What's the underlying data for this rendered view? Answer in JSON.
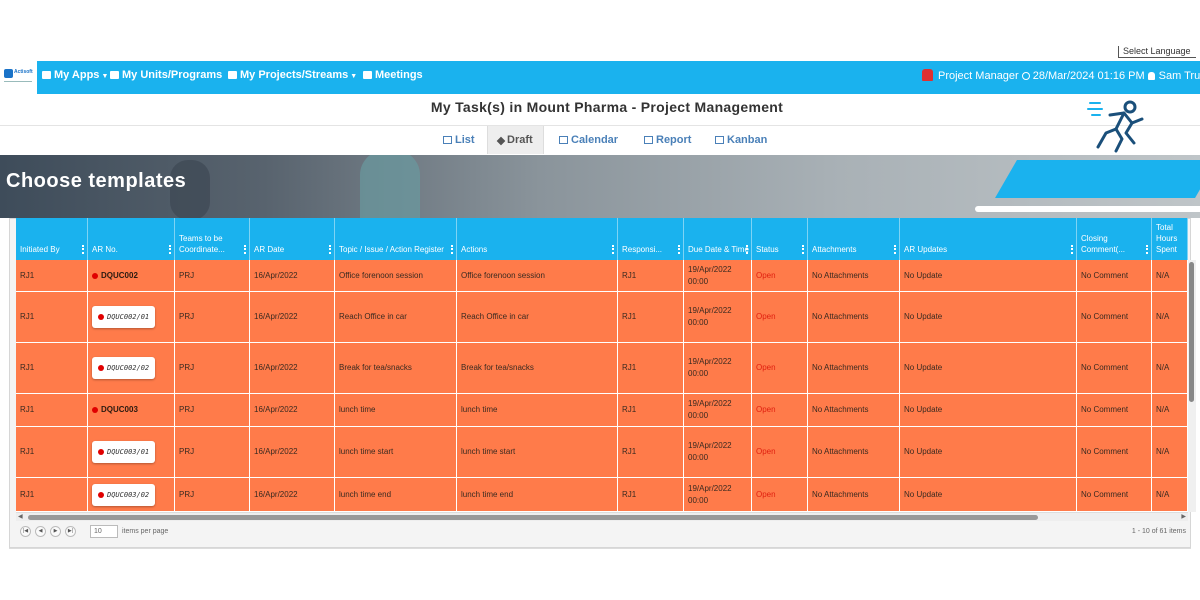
{
  "language_selector": "Select Language",
  "app": {
    "logo_text": "Actisoft"
  },
  "nav": {
    "items": [
      {
        "label": "My Apps",
        "has_caret": true
      },
      {
        "label": "My Units/Programs",
        "has_caret": false
      },
      {
        "label": "My Projects/Streams",
        "has_caret": true
      },
      {
        "label": "Meetings",
        "has_caret": false
      }
    ],
    "role": "Project Manager",
    "datetime": "28/Mar/2024 01:16 PM",
    "user": "Sam Tru"
  },
  "page_title": "My Task(s) in Mount Pharma - Project Management",
  "tabs": [
    {
      "label": "List",
      "icon": "list-icon"
    },
    {
      "label": "Draft",
      "icon": "send-icon",
      "active": true
    },
    {
      "label": "Calendar",
      "icon": "calendar-icon"
    },
    {
      "label": "Report",
      "icon": "tag-icon"
    },
    {
      "label": "Kanban",
      "icon": "chart-icon"
    }
  ],
  "banner": {
    "title": "Choose  templates"
  },
  "grid": {
    "columns": [
      "Initiated By",
      "AR No.",
      "Teams to be Coordinate...",
      "AR Date",
      "Topic / Issue / Action Register",
      "Actions",
      "Responsi...",
      "Due Date & Time",
      "Status",
      "Attachments",
      "AR Updates",
      "Closing Comment(...",
      "Total Hours Spent"
    ],
    "rows": [
      {
        "initiated_by": "RJ1",
        "ar_no": "DQUC002",
        "ar_style": "dot",
        "teams": "PRJ",
        "ar_date": "16/Apr/2022",
        "topic": "Office forenoon session",
        "actions": "Office forenoon session",
        "resp": "RJ1",
        "due": "19/Apr/2022 00:00",
        "status": "Open",
        "attachments": "No Attachments",
        "updates": "No Update",
        "closing": "No Comment",
        "hours": "N/A"
      },
      {
        "initiated_by": "RJ1",
        "ar_no": "DQUC002/01",
        "ar_style": "chip",
        "teams": "PRJ",
        "ar_date": "16/Apr/2022",
        "topic": "Reach Office in car",
        "actions": "Reach Office in car",
        "resp": "RJ1",
        "due": "19/Apr/2022 00:00",
        "status": "Open",
        "attachments": "No Attachments",
        "updates": "No Update",
        "closing": "No Comment",
        "hours": "N/A"
      },
      {
        "initiated_by": "RJ1",
        "ar_no": "DQUC002/02",
        "ar_style": "chip",
        "teams": "PRJ",
        "ar_date": "16/Apr/2022",
        "topic": "Break for tea/snacks",
        "actions": "Break for tea/snacks",
        "resp": "RJ1",
        "due": "19/Apr/2022 00:00",
        "status": "Open",
        "attachments": "No Attachments",
        "updates": "No Update",
        "closing": "No Comment",
        "hours": "N/A"
      },
      {
        "initiated_by": "RJ1",
        "ar_no": "DQUC003",
        "ar_style": "dot",
        "teams": "PRJ",
        "ar_date": "16/Apr/2022",
        "topic": "lunch time",
        "actions": "lunch time",
        "resp": "RJ1",
        "due": "19/Apr/2022 00:00",
        "status": "Open",
        "attachments": "No Attachments",
        "updates": "No Update",
        "closing": "No Comment",
        "hours": "N/A"
      },
      {
        "initiated_by": "RJ1",
        "ar_no": "DQUC003/01",
        "ar_style": "chip",
        "teams": "PRJ",
        "ar_date": "16/Apr/2022",
        "topic": "lunch time start",
        "actions": "lunch time start",
        "resp": "RJ1",
        "due": "19/Apr/2022 00:00",
        "status": "Open",
        "attachments": "No Attachments",
        "updates": "No Update",
        "closing": "No Comment",
        "hours": "N/A"
      },
      {
        "initiated_by": "RJ1",
        "ar_no": "DQUC003/02",
        "ar_style": "chip",
        "teams": "PRJ",
        "ar_date": "16/Apr/2022",
        "topic": "lunch time end",
        "actions": "lunch time end",
        "resp": "RJ1",
        "due": "19/Apr/2022 00:00",
        "status": "Open",
        "attachments": "No Attachments",
        "updates": "No Update",
        "closing": "No Comment",
        "hours": "N/A"
      }
    ]
  },
  "pager": {
    "page_size": "10",
    "page_size_label": "items per page",
    "count": "1 - 10 of 61 items"
  },
  "colors": {
    "accent": "#1ab2ee",
    "row": "#ff7b4a",
    "status_open": "#e02010"
  }
}
